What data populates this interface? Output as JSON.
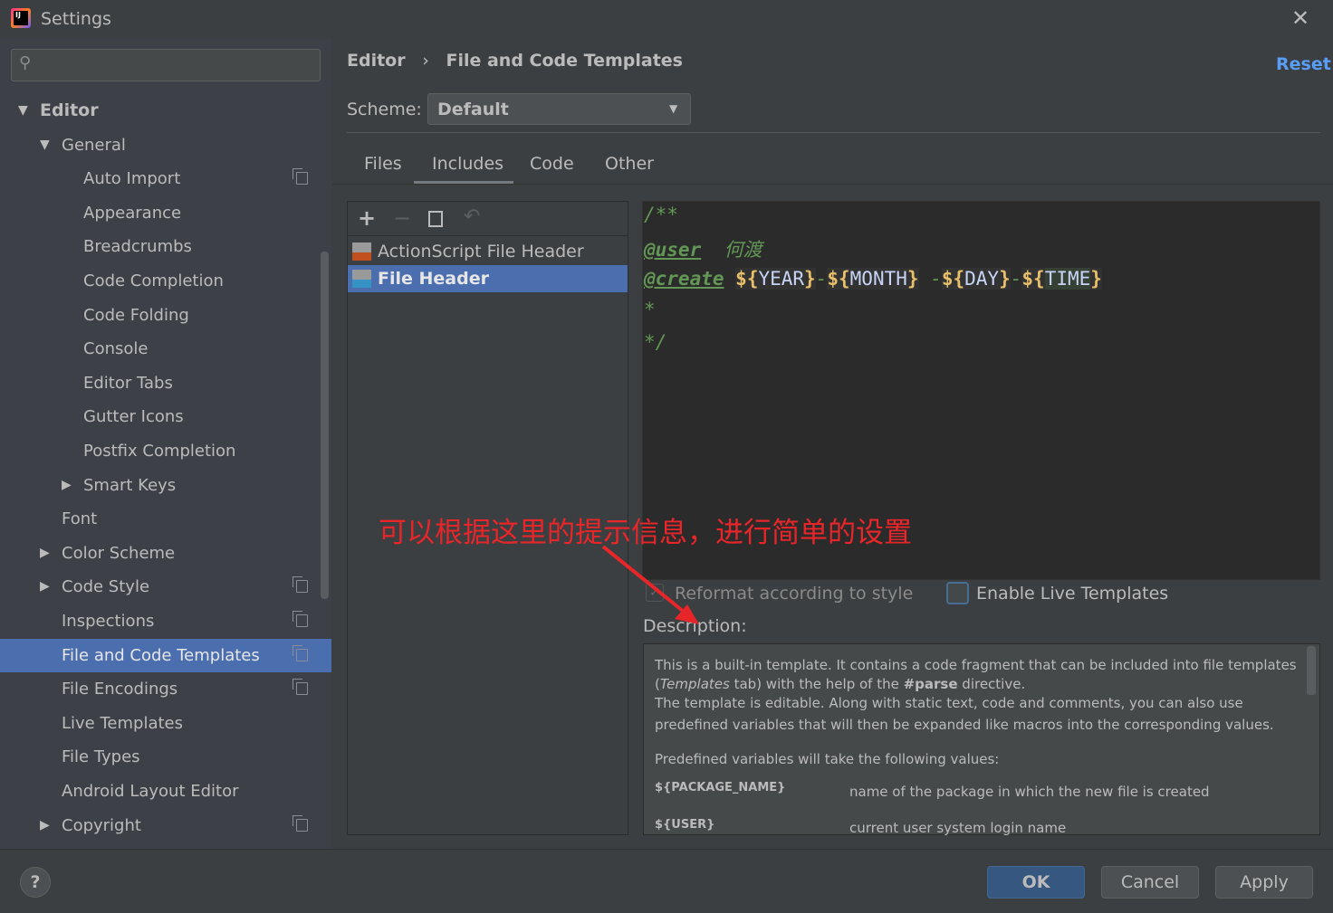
{
  "window": {
    "title": "Settings",
    "app_icon": "intellij-idea-icon",
    "close_icon": "close-icon"
  },
  "search": {
    "placeholder": "",
    "value": ""
  },
  "sidebar": {
    "items": [
      {
        "label": "Editor",
        "level": 0,
        "expanded": true,
        "bold": true
      },
      {
        "label": "General",
        "level": 1,
        "expanded": true
      },
      {
        "label": "Auto Import",
        "level": 2,
        "copy": true
      },
      {
        "label": "Appearance",
        "level": 2
      },
      {
        "label": "Breadcrumbs",
        "level": 2
      },
      {
        "label": "Code Completion",
        "level": 2
      },
      {
        "label": "Code Folding",
        "level": 2
      },
      {
        "label": "Console",
        "level": 2
      },
      {
        "label": "Editor Tabs",
        "level": 2
      },
      {
        "label": "Gutter Icons",
        "level": 2
      },
      {
        "label": "Postfix Completion",
        "level": 2
      },
      {
        "label": "Smart Keys",
        "level": 2,
        "collapsed": true
      },
      {
        "label": "Font",
        "level": 1
      },
      {
        "label": "Color Scheme",
        "level": 1,
        "collapsed": true
      },
      {
        "label": "Code Style",
        "level": 1,
        "collapsed": true,
        "copy": true
      },
      {
        "label": "Inspections",
        "level": 1,
        "copy": true
      },
      {
        "label": "File and Code Templates",
        "level": 1,
        "copy": true,
        "selected": true
      },
      {
        "label": "File Encodings",
        "level": 1,
        "copy": true
      },
      {
        "label": "Live Templates",
        "level": 1
      },
      {
        "label": "File Types",
        "level": 1
      },
      {
        "label": "Android Layout Editor",
        "level": 1
      },
      {
        "label": "Copyright",
        "level": 1,
        "collapsed": true,
        "copy": true
      }
    ]
  },
  "header": {
    "breadcrumb": [
      "Editor",
      "File and Code Templates"
    ],
    "reset": "Reset"
  },
  "scheme": {
    "label": "Scheme:",
    "value": "Default"
  },
  "tabs": [
    {
      "label": "Files"
    },
    {
      "label": "Includes",
      "active": true
    },
    {
      "label": "Code"
    },
    {
      "label": "Other"
    }
  ],
  "templates": {
    "items": [
      {
        "label": "ActionScript File Header",
        "icon": "as-file-icon"
      },
      {
        "label": "File Header",
        "icon": "java-file-icon",
        "selected": true
      }
    ]
  },
  "editor": {
    "line1": "/**",
    "user_tag": "@user",
    "user_name": "何渡",
    "create_tag": "@create",
    "vars": [
      "YEAR",
      "MONTH",
      "DAY",
      "TIME"
    ],
    "line4": "*",
    "line5": "*/"
  },
  "annotation": {
    "text": "可以根据这里的提示信息，进行简单的设置",
    "color": "#e8262a"
  },
  "options": {
    "reformat": {
      "label": "Reformat according to style",
      "checked": true,
      "disabled": true
    },
    "live": {
      "label": "Enable Live Templates",
      "checked": false
    }
  },
  "description": {
    "label": "Description:",
    "p1a": "This is a built-in template. It contains a code fragment that can be included into file templates",
    "p1b_open": "(",
    "p1b_italic": "Templates",
    "p1b_mid": " tab) with the help of the ",
    "p1b_bold": "#parse",
    "p1b_end": " directive.",
    "p2a": "The template is editable. Along with static text, code and comments, you can also use",
    "p2b": "predefined variables that will then be expanded like macros into the corresponding values.",
    "p3": "Predefined variables will take the following values:",
    "vars": [
      {
        "name": "${PACKAGE_NAME}",
        "desc": "name of the package in which the new file is created"
      },
      {
        "name": "${USER}",
        "desc": "current user system login name"
      }
    ]
  },
  "footer": {
    "ok": "OK",
    "cancel": "Cancel",
    "apply": "Apply",
    "help": "?"
  },
  "colors": {
    "accent": "#4b6eaf",
    "link": "#589df6",
    "ok_button": "#365880"
  }
}
